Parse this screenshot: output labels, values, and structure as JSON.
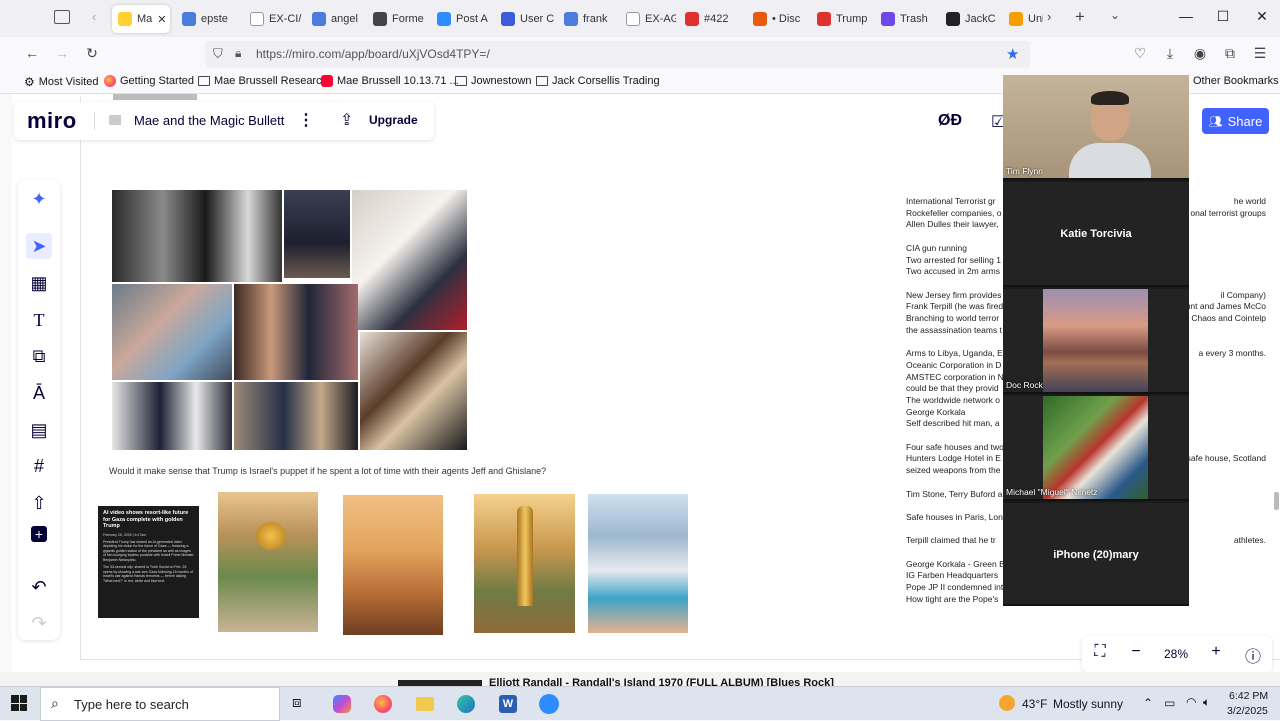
{
  "browser": {
    "tabs": [
      {
        "label": "Ma",
        "color": "#ffd02f",
        "active": true
      },
      {
        "label": "epste",
        "color": "#4a7cde"
      },
      {
        "label": "EX-CI/",
        "color": "#ffffff"
      },
      {
        "label": "angel",
        "color": "#4a7cde"
      },
      {
        "label": "Forme",
        "color": "#444444"
      },
      {
        "label": "Post A",
        "color": "#2d8cff"
      },
      {
        "label": "User C",
        "color": "#3b5bdb"
      },
      {
        "label": "frank",
        "color": "#4a7cde"
      },
      {
        "label": "EX-AG",
        "color": "#ffffff"
      },
      {
        "label": "#422",
        "color": "#e03131"
      },
      {
        "label": "• Disc",
        "color": "#e8590c"
      },
      {
        "label": "Trump",
        "color": "#e03131"
      },
      {
        "label": "Trash",
        "color": "#7048e8"
      },
      {
        "label": "JackC",
        "color": "#222222"
      },
      {
        "label": "Univ",
        "color": "#f59f00"
      }
    ],
    "url": "https://miro.com/app/board/uXjVOsd4TPY=/",
    "bookmarks": [
      {
        "label": "Most Visited",
        "icon": "gear-icon"
      },
      {
        "label": "Getting Started",
        "icon": "firefox-icon"
      },
      {
        "label": "Mae Brussell Research",
        "icon": "folder-icon"
      },
      {
        "label": "Mae Brussell 10.13.71 ...",
        "icon": "youtube-icon"
      },
      {
        "label": "Jownestown",
        "icon": "folder-icon"
      },
      {
        "label": "Jack Corsellis Trading",
        "icon": "folder-icon"
      }
    ],
    "other_bookmarks": "Other Bookmarks"
  },
  "miro": {
    "logo": "miro",
    "board_title": "Mae and the Magic Bullett",
    "upgrade_label": "Upgrade",
    "share_label": "Share",
    "reactions_label": "ØÐ",
    "zoom_level": "28%",
    "caption": "Would it make sense that Trump is Israel's puppet if he spent a lot of time with their agents Jeff and Ghislane?",
    "news_card": {
      "headline": "AI video shows resort-like future for Gaza complete with golden Trump",
      "date": "February 26, 2025 | 6:47am",
      "body": "President Trump has shared an AI-generated video depicting his vision for the future of Gaza — featuring a gigantic golden statue of the president as well as images of him lounging topless poolside with Israeli Prime Minister Benjamin Netanyahu.",
      "body2": "The 33-second clip, shared to Truth Social on Feb. 25, opens by showing a war-torn Gaza following 15 months of Israel's war against Hamas terrorists — before asking \"What next?\" in red, white and blue text."
    },
    "notes": [
      [
        "International Terrorist gr",
        "Rockefeller companies, o",
        "Allen Dulles their lawyer,"
      ],
      [
        "CIA gun running",
        "Two arrested for selling 1",
        "Two accused in 2m arms"
      ],
      [
        "New Jersey firm provides",
        "Frank Terpill (he was fired",
        "Branching to world terror",
        "the assassination teams t"
      ],
      [
        "Arms to Libya, Uganda, E",
        "Oceanic Corporation in D",
        "AMSTEC corporation in N",
        "could be that they provid",
        "The worldwide network o",
        "George Korkala",
        "Self described hit man, a"
      ],
      [
        "Four safe houses and two",
        "Hunters Lodge Hotel in E",
        "seized weapons from the"
      ],
      [
        "Tim Stone, Terry Buford a"
      ],
      [
        "Safe houses in Paris, Lon"
      ],
      [
        "Terpill claimed that he tr"
      ],
      [
        "George Korkala - Green B",
        "IG Farben Headquarters",
        "Pope JP II condemned int",
        "How tight are the Pope's"
      ]
    ],
    "notes_right": [
      {
        "text": "he world",
        "row": 0
      },
      {
        "text": "onal terrorist groups",
        "row": 1
      },
      {
        "text": "il Company)",
        "row": 8
      },
      {
        "text": "l Hunt and James McCo",
        "row": 9
      },
      {
        "text": "tion Chaos and Cointelp",
        "row": 10
      },
      {
        "text": "a every 3 months.",
        "row": 13
      },
      {
        "text": "tel safe house, Scotland",
        "row": 22
      },
      {
        "text": "athletes.",
        "row": 29
      }
    ]
  },
  "zoom_call": {
    "participants": [
      {
        "name": "Tim Flynn",
        "video": "face"
      },
      {
        "name": "Katie Torcivia",
        "video": "none"
      },
      {
        "name": "Doc Rock",
        "video": "landscape"
      },
      {
        "name": "Michael \"Miguel\" Nimetz",
        "video": "soccer"
      },
      {
        "name": "iPhone (20)mary",
        "video": "none"
      }
    ]
  },
  "underlying_window": {
    "text": "Elliott Randall - Randall's Island 1970 (FULL ALBUM) [Blues Rock]"
  },
  "taskbar": {
    "search_placeholder": "Type here to search",
    "weather_temp": "43°F",
    "weather_desc": "Mostly sunny",
    "time": "6:42 PM",
    "date": "3/2/2025"
  }
}
